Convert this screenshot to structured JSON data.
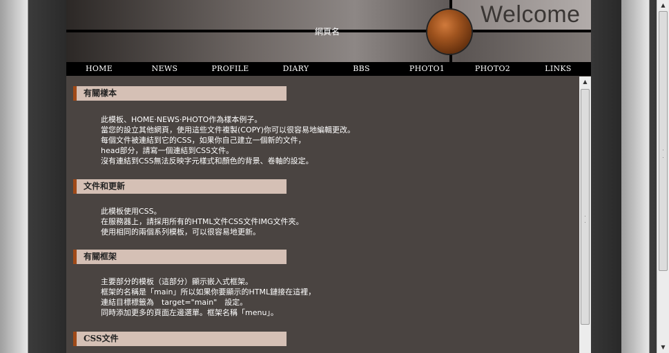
{
  "header": {
    "site_name": "網頁名",
    "welcome": "Welcome"
  },
  "nav": {
    "items": [
      "HOME",
      "NEWS",
      "PROFILE",
      "DIARY",
      "BBS",
      "PHOTO1",
      "PHOTO2",
      "LINKS"
    ]
  },
  "sections": [
    {
      "title": "有關樣本",
      "lines": [
        "此模板、HOME‧NEWS‧PHOTO作為樣本例子。",
        "當您的設立其他網頁，使用這些文件複製(COPY)你可以很容易地編輯更改。",
        "每個文件被連結到它的CSS，如果你自己建立一個新的文件，",
        "head部分，請寫一個連結到CSS文件。",
        "沒有連結到CSS無法反映字元樣式和顏色的背景、卷軸的設定。"
      ]
    },
    {
      "title": "文件和更新",
      "lines": [
        "此模板使用CSS。",
        "在服務器上，請採用所有的HTML文件CSS文件IMG文件夾。",
        "使用相同的兩個系列模板，可以很容易地更新。"
      ]
    },
    {
      "title": "有關框架",
      "lines": [
        "主要部分的模板（這部分）顯示嵌入式框架。",
        "框架的名稱是「main」所以如果你要顯示的HTML鏈接在這裡，",
        "連結目標標籤為　target=\"main\"　設定。",
        "同時添加更多的頁面左邊選單。框架名稱「menu」。"
      ]
    },
    {
      "title": "CSS文件",
      "lines": []
    }
  ]
}
